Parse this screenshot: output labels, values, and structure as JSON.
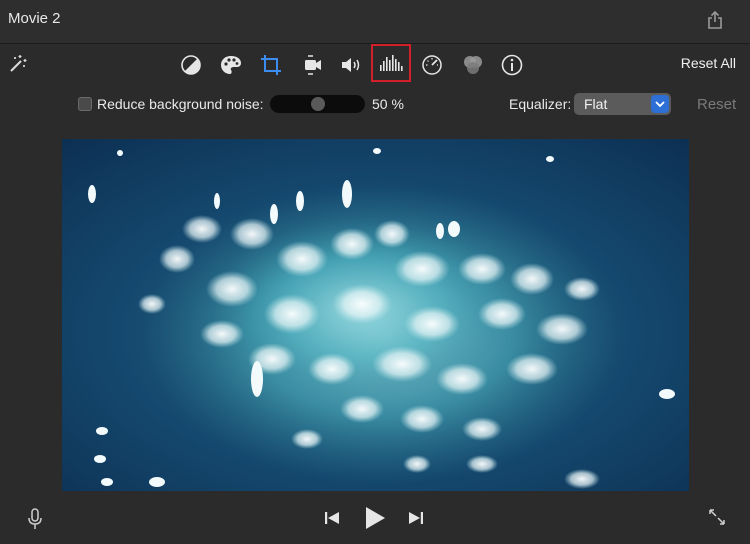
{
  "window": {
    "title": "Movie 2"
  },
  "toolbar": {
    "tools": [
      {
        "name": "color-balance-icon"
      },
      {
        "name": "color-correction-icon"
      },
      {
        "name": "crop-icon"
      },
      {
        "name": "stabilization-icon"
      },
      {
        "name": "volume-icon"
      },
      {
        "name": "noise-reduction-equalizer-icon",
        "selected": true
      },
      {
        "name": "speed-icon"
      },
      {
        "name": "clip-filter-icon"
      },
      {
        "name": "info-icon"
      }
    ],
    "reset_all_label": "Reset All"
  },
  "noise": {
    "checkbox_label": "Reduce background noise:",
    "checked": false,
    "level_percent": 50,
    "value_text": "50 %"
  },
  "equalizer": {
    "label": "Equalizer:",
    "selected": "Flat",
    "reset_label": "Reset"
  },
  "colors": {
    "accent": "#2e6fd6",
    "highlight_outline": "#d21f2a",
    "background": "#2b2b2b"
  }
}
